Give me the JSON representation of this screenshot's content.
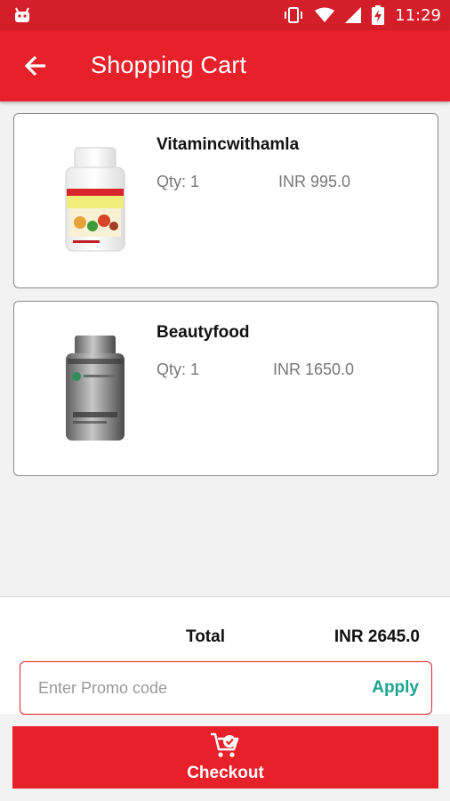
{
  "status_bar": {
    "time": "11:29",
    "icons": [
      "android-notification-icon",
      "vibrate-icon",
      "wifi-icon",
      "signal-icon",
      "battery-charging-icon"
    ]
  },
  "app_bar": {
    "title": "Shopping Cart",
    "back_icon": "arrow-left-icon"
  },
  "cart": {
    "items": [
      {
        "name": "Vitamincwithamla",
        "qty": "Qty: 1",
        "price": "INR 995.0",
        "image": "white-vitamin-bottle"
      },
      {
        "name": "Beautyfood",
        "qty": "Qty: 1",
        "price": "INR 1650.0",
        "image": "silver-supplement-bottle"
      }
    ]
  },
  "summary": {
    "total_label": "Total",
    "total_value": "INR 2645.0"
  },
  "promo": {
    "placeholder": "Enter Promo code",
    "value": "",
    "apply_label": "Apply"
  },
  "checkout": {
    "label": "Checkout",
    "icon": "cart-check-icon"
  },
  "colors": {
    "status_bar": "#d41f2a",
    "primary": "#e8202a",
    "accent": "#1aa391",
    "background": "#f2f2f2"
  }
}
